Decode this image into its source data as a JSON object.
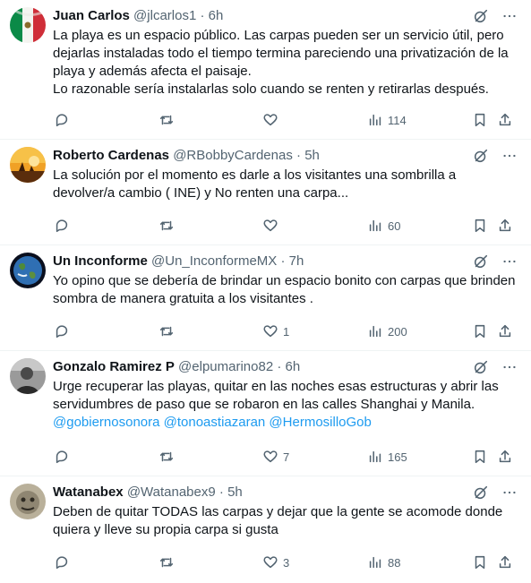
{
  "tweets": [
    {
      "name": "Juan Carlos",
      "handle": "@jlcarlos1",
      "dot": "·",
      "time": "6h",
      "lines": [
        "La playa es un espacio público. Las carpas pueden ser un servicio útil, pero dejarlas instaladas todo el tiempo termina pareciendo una privatización de la playa y además afecta el paisaje.",
        "Lo razonable sería instalarlas solo cuando se renten y retirarlas después."
      ],
      "mentions": "",
      "likes": "",
      "views": "114",
      "avatar_icon": "mexico-flag-avatar"
    },
    {
      "name": "Roberto Cardenas",
      "handle": "@RBobbyCardenas",
      "dot": "·",
      "time": "5h",
      "lines": [
        "La solución por el momento es darle a los visitantes una sombrilla a devolver/a cambio ( INE) y No renten una carpa..."
      ],
      "mentions": "",
      "likes": "",
      "views": "60",
      "avatar_icon": "sunset-avatar"
    },
    {
      "name": "Un Inconforme",
      "handle": "@Un_InconformeMX",
      "dot": "·",
      "time": "7h",
      "lines": [
        "Yo opino que se debería de brindar un espacio bonito con carpas que brinden sombra de manera gratuita a los visitantes ."
      ],
      "mentions": "",
      "likes": "1",
      "views": "200",
      "avatar_icon": "earth-avatar"
    },
    {
      "name": "Gonzalo Ramirez P",
      "handle": "@elpumarino82",
      "dot": "·",
      "time": "6h",
      "lines": [
        "Urge recuperar las playas, quitar en las noches esas estructuras y abrir las servidumbres de paso que se robaron en las calles Shanghai y Manila."
      ],
      "mentions": "@gobiernosonora @tonoastiazaran @HermosilloGob",
      "likes": "7",
      "views": "165",
      "avatar_icon": "person-avatar"
    },
    {
      "name": "Watanabex",
      "handle": "@Watanabex9",
      "dot": "·",
      "time": "5h",
      "lines": [
        "Deben de quitar TODAS las carpas y dejar que la gente se acomode donde quiera y lleve su propia carpa si gusta"
      ],
      "mentions": "",
      "likes": "3",
      "views": "88",
      "avatar_icon": "face-avatar"
    }
  ]
}
